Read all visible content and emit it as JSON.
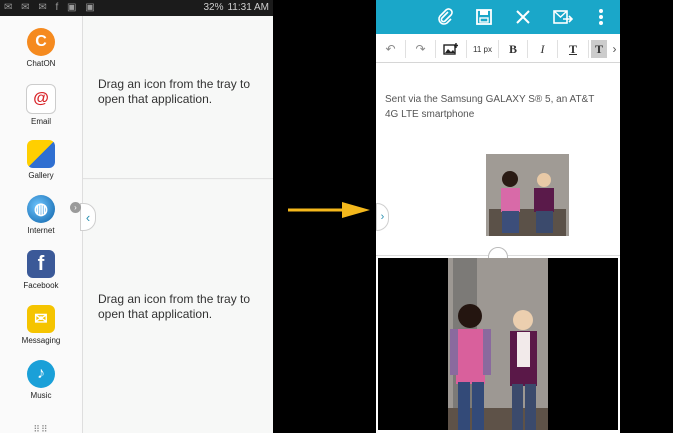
{
  "left_phone": {
    "status": {
      "time": "11:31 AM",
      "battery": "32%"
    },
    "tray_apps": [
      {
        "label": "ChatON",
        "icon": "chaton-icon",
        "color": "#f58a1f",
        "glyph": "C"
      },
      {
        "label": "Email",
        "icon": "email-icon",
        "color": "#ffffff",
        "glyph": "@"
      },
      {
        "label": "Gallery",
        "icon": "gallery-icon",
        "color": "#2f6fd1",
        "glyph": "▦"
      },
      {
        "label": "Internet",
        "icon": "internet-icon",
        "color": "#1d7fc2",
        "glyph": "◍"
      },
      {
        "label": "Facebook",
        "icon": "facebook-icon",
        "color": "#3b5998",
        "glyph": "f"
      },
      {
        "label": "Messaging",
        "icon": "messaging-icon",
        "color": "#f5c400",
        "glyph": "✉"
      },
      {
        "label": "Music",
        "icon": "music-icon",
        "color": "#1aa0d8",
        "glyph": "♪"
      }
    ],
    "top_panel_message": "Drag an icon from the tray to open that application.",
    "bottom_panel_message": "Drag an icon from the tray to open that application."
  },
  "arrow_color": "#f4b81c",
  "right_phone": {
    "accent": "#1aa7c9",
    "actions": [
      "attach-icon",
      "save-icon",
      "discard-icon",
      "send-icon",
      "more-icon"
    ],
    "format_toolbar": {
      "undo": "↶",
      "redo": "↷",
      "insert_image": "insert-image-icon",
      "font_size": "11 px",
      "bold": "B",
      "italic": "I",
      "text_color": "T",
      "highlight": "T",
      "more": "›"
    },
    "signature": "Sent via the Samsung GALAXY S® 5, an AT&T 4G LTE smartphone"
  }
}
